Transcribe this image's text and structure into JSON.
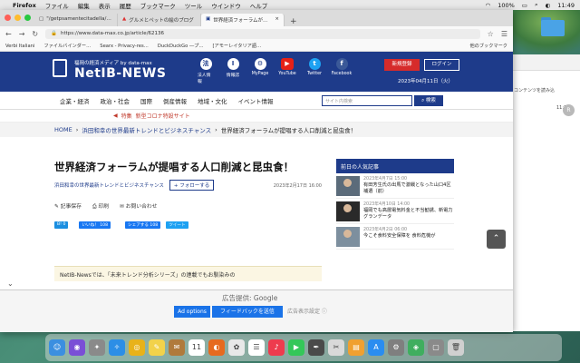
{
  "menubar": {
    "app": "Firefox",
    "items": [
      "ファイル",
      "編集",
      "表示",
      "履歴",
      "ブックマーク",
      "ツール",
      "ウインドウ",
      "ヘルプ"
    ],
    "battery": "100%",
    "clock": "11:49"
  },
  "browser": {
    "tabs": [
      {
        "label": "\"/getpsamentecitadella/10042022\""
      },
      {
        "label": "グルメとペットの絵のブログ"
      },
      {
        "label": "世界経済フォーラムが提唱する人"
      }
    ],
    "url": "https://www.data-max.co.jp/article/62136",
    "bookmarks": [
      "Verbi Italiani",
      "ファイルバインダー…",
      "Searx - Privacy-res…",
      "DuckDuckGo ―プ…",
      "[アモーレイタリア語…"
    ],
    "other_bookmarks": "他のブックマーク"
  },
  "site": {
    "tagline": "福岡の経済メディア by data-max",
    "logo": "NetIB-NEWS",
    "header_icons": [
      {
        "label": "法人情報",
        "glyph": "法"
      },
      {
        "label": "情報誌",
        "glyph": "I"
      },
      {
        "label": "MyPage",
        "glyph": "⚙"
      },
      {
        "label": "YouTube",
        "glyph": "▶"
      },
      {
        "label": "Twitter",
        "glyph": "t"
      },
      {
        "label": "Facebook",
        "glyph": "f"
      }
    ],
    "register": "新規登録",
    "login": "ログイン",
    "date": "2023年04月11日（火）",
    "nav": [
      "企業・経済",
      "政治・社会",
      "国際",
      "倒産情報",
      "地域・文化",
      "イベント情報"
    ],
    "search_placeholder": "サイト内検索",
    "search_button": "検索",
    "special_tag": "特集",
    "special_link": "新型コロナ特設サイト"
  },
  "breadcrumb": {
    "home": "HOME",
    "section": "浜田和幸の世界最新トレンドとビジネスチャンス",
    "current": "世界経済フォーラムが提唱する人口削減と昆虫食！"
  },
  "article": {
    "title": "世界経済フォーラムが提唱する人口削減と昆虫食！",
    "series": "浜田和幸の世界最新トレンドとビジネスチャンス",
    "follow": "+ フォローする",
    "date": "2023年2月17日 16:00",
    "save": "記事保存",
    "print": "印刷",
    "contact": "お問い合わせ",
    "shares": [
      {
        "label": "B! 0",
        "color": "#1b8ee0"
      },
      {
        "label": "いいね！ 108",
        "color": "#1877f2"
      },
      {
        "label": "シェアする 108",
        "color": "#1877f2"
      },
      {
        "label": "ツイート",
        "color": "#1da1f2"
      }
    ],
    "lead": "NetIB-Newsでは、「未来トレンド分析シリーズ」の連載でもお馴染みの"
  },
  "sidebar": {
    "heading": "前日の人気記事",
    "items": [
      {
        "date": "2023年4月7日 15:00",
        "title": "有田芳生氏の出馬で激戦となった山口4区補選（前）"
      },
      {
        "date": "2023年4月10日 14:00",
        "title": "福岡でも高層電気料金と不当勧誘、新電力グランデータ"
      },
      {
        "date": "2023年4月2日 06:00",
        "title": "今こそ食料安全保障を 食料危機が"
      }
    ]
  },
  "ad": {
    "label": "広告提供: Google",
    "options": "Ad options",
    "feedback": "フィードバックを送信",
    "settings": "広告表示設定 ⓘ"
  },
  "background_window": {
    "line1": "コンテンツを読み込",
    "time": "11:31",
    "avatar": "R"
  },
  "dock": {
    "apps": [
      {
        "name": "finder",
        "color": "#3b8fe0",
        "glyph": "☺"
      },
      {
        "name": "siri",
        "color": "#7a4fd6",
        "glyph": "◉"
      },
      {
        "name": "launchpad",
        "color": "#8a8a8a",
        "glyph": "✦"
      },
      {
        "name": "safari",
        "color": "#2c8ee6",
        "glyph": "✧"
      },
      {
        "name": "chrome",
        "color": "#e8b21a",
        "glyph": "◎"
      },
      {
        "name": "notes",
        "color": "#f2d24b",
        "glyph": "✎"
      },
      {
        "name": "mail-stamp",
        "color": "#b07a3c",
        "glyph": "✉"
      },
      {
        "name": "calendar",
        "color": "#ffffff",
        "glyph": "11"
      },
      {
        "name": "firefox",
        "color": "#e66a1f",
        "glyph": "◐"
      },
      {
        "name": "photos",
        "color": "#e8e8e8",
        "glyph": "✿"
      },
      {
        "name": "reminders",
        "color": "#ffffff",
        "glyph": "☰"
      },
      {
        "name": "music",
        "color": "#ee3b4e",
        "glyph": "♪"
      },
      {
        "name": "facetime",
        "color": "#34c759",
        "glyph": "▶"
      },
      {
        "name": "unknown-app",
        "color": "#4a4a4a",
        "glyph": "✒"
      },
      {
        "name": "script-editor",
        "color": "#d9d9d9",
        "glyph": "✂"
      },
      {
        "name": "books",
        "color": "#f0a030",
        "glyph": "▤"
      },
      {
        "name": "app-store",
        "color": "#2a8df0",
        "glyph": "A"
      },
      {
        "name": "system-preferences",
        "color": "#7f7f7f",
        "glyph": "⚙"
      },
      {
        "name": "contacts-green",
        "color": "#3fae5f",
        "glyph": "◈"
      },
      {
        "name": "screenshot",
        "color": "#8a8a8a",
        "glyph": "▢"
      },
      {
        "name": "trash",
        "color": "#d0d0d0",
        "glyph": "🗑"
      }
    ]
  }
}
